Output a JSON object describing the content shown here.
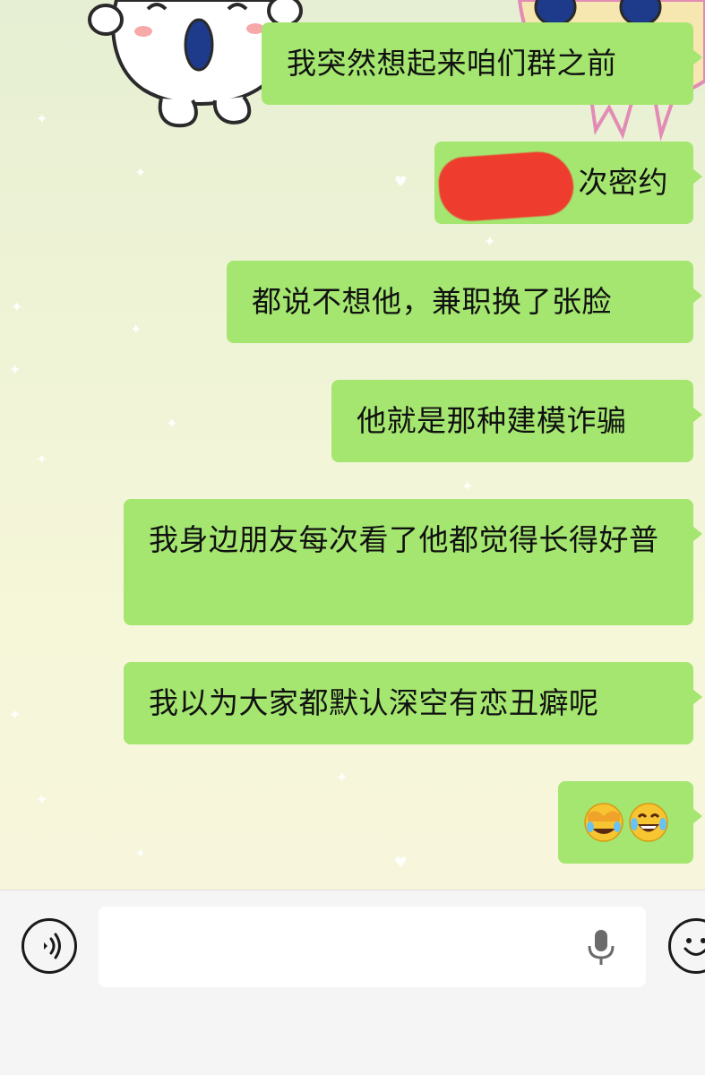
{
  "messages": [
    {
      "text": "我突然想起来咱们群之前"
    },
    {
      "text": "次密约",
      "redacted_prefix": true
    },
    {
      "text": "都说不想他，兼职换了张脸"
    },
    {
      "text": "他就是那种建模诈骗"
    },
    {
      "text": "我身边朋友每次看了他都觉得长得好普"
    },
    {
      "text": "我以为大家都默认深空有恋丑癖呢"
    },
    {
      "text": "",
      "emojis": [
        "face-with-hand-over-eyes-laughing",
        "face-with-tears-of-joy"
      ]
    }
  ],
  "input": {
    "value": "",
    "placeholder": ""
  },
  "colors": {
    "bubble": "#a4e66f",
    "redaction": "#ee3d2e",
    "input_bar": "#f5f5f5"
  },
  "icons": {
    "voice": "voice-icon",
    "mic": "microphone-icon",
    "emoji": "emoji-icon"
  }
}
